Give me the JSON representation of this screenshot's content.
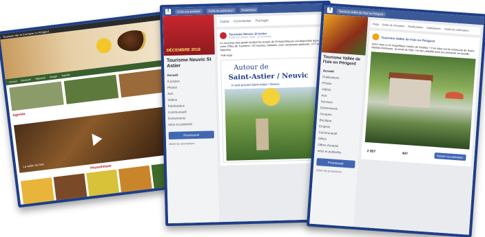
{
  "website": {
    "top_text": "Tourisme Isle et Crempse en Périgord",
    "nav": [
      "Accueil",
      "Découvrir",
      "Séjourner",
      "Bouger",
      "Agenda"
    ],
    "agenda": "Agenda",
    "video_caption": "La vallée de l'Isle",
    "section_title": "Photothèque"
  },
  "fb_neuvic": {
    "top_items": [
      "Créer une publicité",
      "Outils de publication",
      "Paramètres"
    ],
    "cover_text": "DÉCEMBRE 2018",
    "page_name": "Tourisme Neuvic St Astier",
    "menu": [
      "Accueil",
      "À propos",
      "Photos",
      "Avis",
      "Vidéos",
      "Publications",
      "Communauté",
      "Événements",
      "Infos et publicités"
    ],
    "promote_button": "Promouvoir",
    "manage": "Gérer les promotions",
    "actions": [
      "J'aime",
      "Commenter",
      "Partager"
    ],
    "post_author": "Tourisme Neuvic St Astier",
    "post_meta": "Publié par Jeanne Tessa · 12 novembre",
    "post_text": "Le nouveau plan guide randonnée autour de St Astier/Neuvic est disponible dans votre Office de Tourisme ! 22 boucles, balisées, pour randonnée pédestre, VTT et équestre.",
    "post_tag": "Trail vega",
    "guide_title_1": "Autour de",
    "guide_title_2": "Saint-Astier / Neuvic",
    "guide_subtitle": "In and around Saint-Astier / Neuvic"
  },
  "fb_isle": {
    "top_bar_title": "Tourisme Vallée de l'Isle en Périgord",
    "page_name": "Tourisme Vallée de l'Isle en Périgord",
    "tabs": [
      "Page",
      "Boîte de réception",
      "Notifications",
      "Statistiques",
      "Outils de publication"
    ],
    "menu": [
      "Accueil",
      "Publications",
      "Photos",
      "Vidéos",
      "Avis",
      "Services",
      "Événements",
      "Groupes",
      "Boutique",
      "Emplois",
      "Communauté",
      "Offres",
      "Offres d'emploi",
      "Infos et publicités"
    ],
    "promote_button": "Promouvoir",
    "manage": "Gérer les promotions",
    "post_author": "Tourisme Vallée de l'Isle en Périgord",
    "post_text": "Avez-vous vu le magnifique moulin de Duellas ? Il se situe sur la commune de Saint-Martial-d'Artenset, au bord de l'Isle. Un lieu paisible pour se promener en famille.",
    "stat_likes": "2 857",
    "stat_follows": "497",
    "stat_button": "Booster la publication"
  }
}
